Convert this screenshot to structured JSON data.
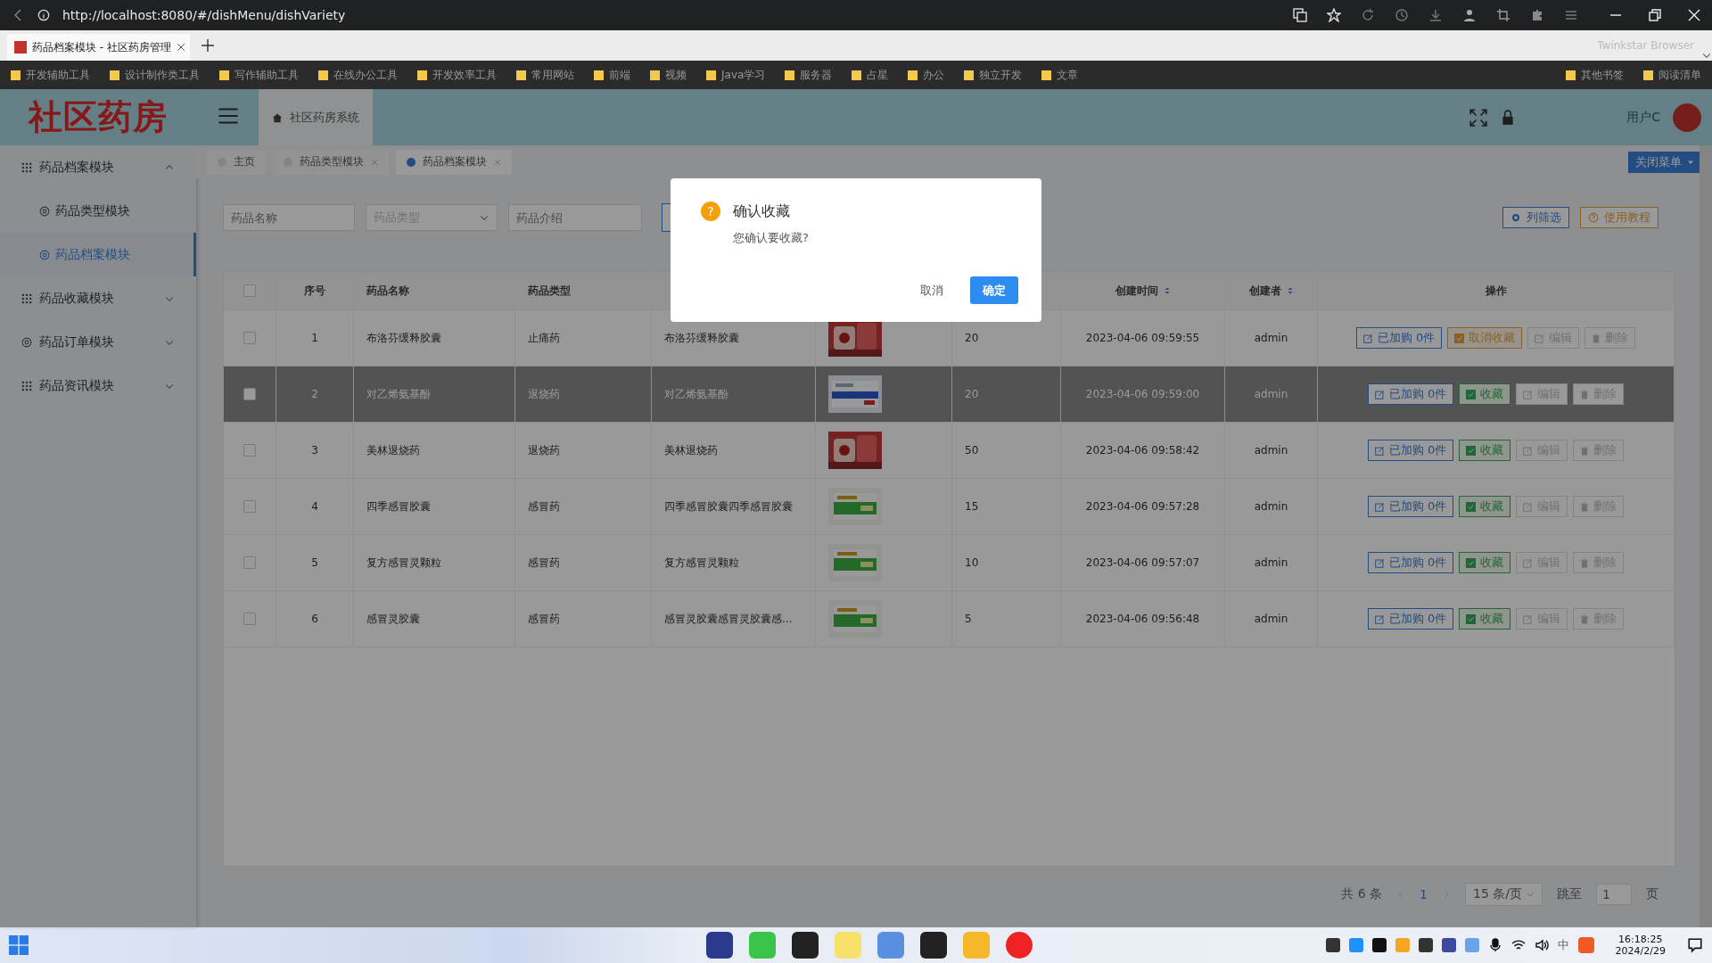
{
  "browser": {
    "url": "http://localhost:8080/#/dishMenu/dishVariety",
    "tab_title": "药品档案模块 - 社区药房管理",
    "brand": "Twinkstar Browser",
    "bookmarks": [
      "开发辅助工具",
      "设计制作类工具",
      "写作辅助工具",
      "在线办公工具",
      "开发效率工具",
      "常用网站",
      "前端",
      "视频",
      "Java学习",
      "服务器",
      "占星",
      "办公",
      "独立开发",
      "文章"
    ],
    "bookmarks_right": [
      "其他书签",
      "阅读清单"
    ]
  },
  "sidebar": {
    "logo": "社区药房",
    "items": [
      {
        "label": "药品档案模块",
        "kind": "grid",
        "expanded": true,
        "children": [
          {
            "label": "药品类型模块",
            "selected": false
          },
          {
            "label": "药品档案模块",
            "selected": true
          }
        ]
      },
      {
        "label": "药品收藏模块",
        "kind": "grid",
        "expanded": false
      },
      {
        "label": "药品订单模块",
        "kind": "circle",
        "expanded": false
      },
      {
        "label": "药品资讯模块",
        "kind": "grid",
        "expanded": false
      }
    ]
  },
  "header": {
    "breadcrumb": "社区药房系统",
    "user": "用户C"
  },
  "tabs": [
    {
      "label": "主页",
      "selected": false,
      "closable": false
    },
    {
      "label": "药品类型模块",
      "selected": false,
      "closable": true
    },
    {
      "label": "药品档案模块",
      "selected": true,
      "closable": true
    }
  ],
  "close_menu_button": "关闭菜单",
  "filters": {
    "name_placeholder": "药品名称",
    "type_placeholder": "药品类型",
    "intro_placeholder": "药品介绍"
  },
  "toolbar": [
    "列筛选",
    "使用教程"
  ],
  "table": {
    "all_checked": false,
    "header": {
      "index": "序号",
      "name": "药品名称",
      "type": "药品类型",
      "created": "创建时间",
      "creator": "创建者",
      "actions": "操作"
    },
    "rows": [
      {
        "index": "1",
        "name": "布洛芬缓释胶囊",
        "type": "止痛药",
        "intro": "布洛芬缓释胶囊",
        "stock": "20",
        "created": "2023-04-06 09:59:55",
        "creator": "admin",
        "checked": false,
        "highlighted": false,
        "favorited": true,
        "purchase": "已加购 0件",
        "favorite": "取消收藏",
        "edit": "编辑",
        "delete": "删除"
      },
      {
        "index": "2",
        "name": "对乙烯氨基酚",
        "type": "退烧药",
        "intro": "对乙烯氨基酚",
        "stock": "20",
        "created": "2023-04-06 09:59:00",
        "creator": "admin",
        "checked": false,
        "highlighted": true,
        "favorited": false,
        "purchase": "已加购 0件",
        "favorite": "收藏",
        "edit": "编辑",
        "delete": "删除"
      },
      {
        "index": "3",
        "name": "美林退烧药",
        "type": "退烧药",
        "intro": "美林退烧药",
        "stock": "50",
        "created": "2023-04-06 09:58:42",
        "creator": "admin",
        "checked": false,
        "highlighted": false,
        "favorited": false,
        "purchase": "已加购 0件",
        "favorite": "收藏",
        "edit": "编辑",
        "delete": "删除"
      },
      {
        "index": "4",
        "name": "四季感冒胶囊",
        "type": "感冒药",
        "intro": "四季感冒胶囊四季感冒胶囊",
        "stock": "15",
        "created": "2023-04-06 09:57:28",
        "creator": "admin",
        "checked": false,
        "highlighted": false,
        "favorited": false,
        "purchase": "已加购 0件",
        "favorite": "收藏",
        "edit": "编辑",
        "delete": "删除"
      },
      {
        "index": "5",
        "name": "复方感冒灵颗粒",
        "type": "感冒药",
        "intro": "复方感冒灵颗粒",
        "stock": "10",
        "created": "2023-04-06 09:57:07",
        "creator": "admin",
        "checked": false,
        "highlighted": false,
        "favorited": false,
        "purchase": "已加购 0件",
        "favorite": "收藏",
        "edit": "编辑",
        "delete": "删除"
      },
      {
        "index": "6",
        "name": "感冒灵胶囊",
        "type": "感冒药",
        "intro": "感冒灵胶囊感冒灵胶囊感...",
        "stock": "5",
        "created": "2023-04-06 09:56:48",
        "creator": "admin",
        "checked": false,
        "highlighted": false,
        "favorited": false,
        "purchase": "已加购 0件",
        "favorite": "收藏",
        "edit": "编辑",
        "delete": "删除"
      }
    ]
  },
  "pagination": {
    "total": "共 6 条",
    "page": "1",
    "page_size": "15 条/页",
    "goto": "跳至",
    "goto_value": "1",
    "page_suffix": "页"
  },
  "dialog": {
    "icon": "?",
    "title": "确认收藏",
    "message": "您确认要收藏?",
    "cancel": "取消",
    "confirm": "确定"
  },
  "taskbar": {
    "ime": "中",
    "time": "16:18:25",
    "date": "2024/2/29"
  }
}
